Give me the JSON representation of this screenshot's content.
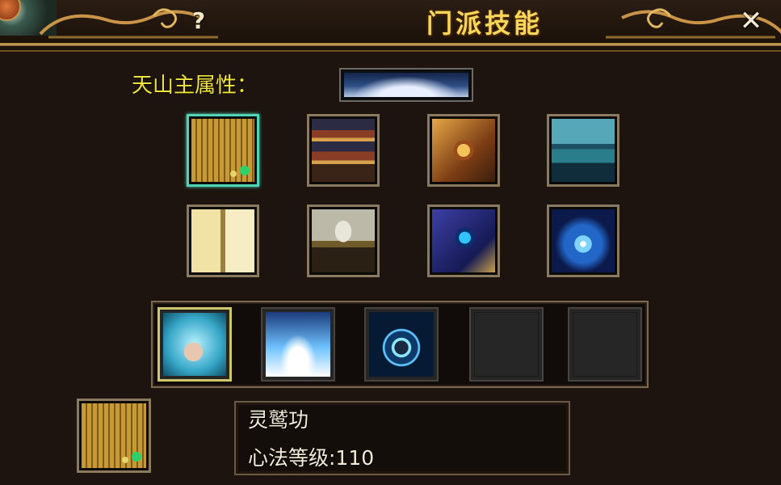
{
  "window": {
    "title": "门派技能",
    "help_label": "?",
    "close_label": "✕"
  },
  "attribute": {
    "label": "天山主属性："
  },
  "books": [
    {
      "icon": "scroll-book-icon",
      "selected": true
    },
    {
      "icon": "stacked-books-icon",
      "selected": false
    },
    {
      "icon": "golden-tome-icon",
      "selected": false
    },
    {
      "icon": "blue-tome-icon",
      "selected": false
    },
    {
      "icon": "open-book-icon",
      "selected": false
    },
    {
      "icon": "silver-tome-icon",
      "selected": false
    },
    {
      "icon": "mystic-scroll-icon",
      "selected": false
    },
    {
      "icon": "galaxy-orb-icon",
      "selected": false
    }
  ],
  "skills": [
    {
      "icon": "fist-strike-icon",
      "active": true
    },
    {
      "icon": "ice-burst-icon",
      "active": false
    },
    {
      "icon": "meditation-aura-icon",
      "active": false
    },
    {
      "icon": "",
      "active": false,
      "empty": true
    },
    {
      "icon": "",
      "active": false,
      "empty": true
    }
  ],
  "selected_info": {
    "name": "灵鹫功",
    "level_text": "心法等级:110"
  },
  "colors": {
    "title_gold": "#f7d75a",
    "attr_yellow": "#f0e43a",
    "selected_border": "#4fd4b6",
    "active_skill_border": "#cfc86a"
  }
}
